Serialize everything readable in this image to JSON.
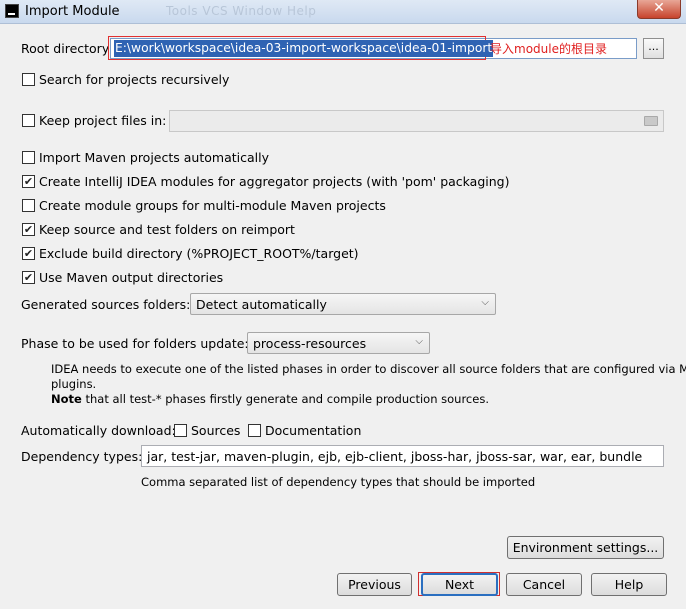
{
  "window": {
    "title": "Import Module",
    "ghost_menu": "Tools   VCS   Window   Help",
    "close_glyph": "✕"
  },
  "root": {
    "label": "Root directory",
    "value": "E:\\work\\workspace\\idea-03-import-workspace\\idea-01-import",
    "annotation": "导入module的根目录",
    "browse_label": "..."
  },
  "options": {
    "search_recursively": {
      "label": "Search for projects recursively",
      "checked": false
    },
    "keep_project_files": {
      "label": "Keep project files in:",
      "checked": false
    },
    "import_maven_auto": {
      "label": "Import Maven projects automatically",
      "checked": false
    },
    "create_modules_aggregator": {
      "label": "Create IntelliJ IDEA modules for aggregator projects (with 'pom' packaging)",
      "checked": true
    },
    "create_module_groups": {
      "label": "Create module groups for multi-module Maven projects",
      "checked": false
    },
    "keep_source_folders": {
      "label": "Keep source and test folders on reimport",
      "checked": true
    },
    "exclude_build_dir": {
      "label": "Exclude build directory (%PROJECT_ROOT%/target)",
      "checked": true
    },
    "use_maven_output": {
      "label": "Use Maven output directories",
      "checked": true
    }
  },
  "generated_sources": {
    "label": "Generated sources folders:",
    "value": "Detect automatically"
  },
  "phase": {
    "label": "Phase to be used for folders update:",
    "value": "process-resources",
    "help_line1": "IDEA needs to execute one of the listed phases in order to discover all source folders that are configured via Maven",
    "help_line2": "plugins.",
    "note_bold": "Note",
    "note_text": " that all test-* phases firstly generate and compile production sources."
  },
  "auto_download": {
    "label": "Automatically download:",
    "sources": {
      "label": "Sources",
      "checked": false
    },
    "documentation": {
      "label": "Documentation",
      "checked": false
    }
  },
  "dependency_types": {
    "label": "Dependency types:",
    "value": "jar, test-jar, maven-plugin, ejb, ejb-client, jboss-har, jboss-sar, war, ear, bundle",
    "hint": "Comma separated list of dependency types that should be imported"
  },
  "buttons": {
    "environment_settings": "Environment settings...",
    "previous": "Previous",
    "next": "Next",
    "cancel": "Cancel",
    "help": "Help"
  }
}
